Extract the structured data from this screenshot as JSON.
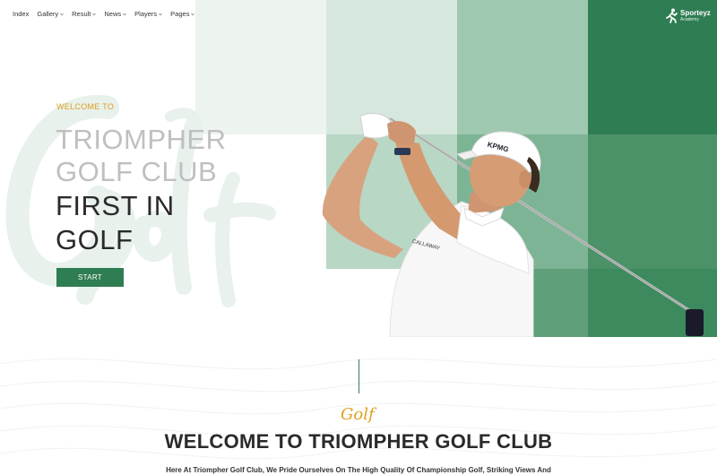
{
  "nav": {
    "items": [
      {
        "label": "Index",
        "has_dropdown": false
      },
      {
        "label": "Gallery",
        "has_dropdown": true
      },
      {
        "label": "Result",
        "has_dropdown": true
      },
      {
        "label": "News",
        "has_dropdown": true
      },
      {
        "label": "Players",
        "has_dropdown": true
      },
      {
        "label": "Pages",
        "has_dropdown": true
      }
    ]
  },
  "brand": {
    "name": "Sporteyz",
    "subtitle": "Academy",
    "icon": "runner-logo-icon"
  },
  "hero": {
    "kicker": "WELCOME TO",
    "title_line1": "TRIOMPHER",
    "title_line2": "GOLF CLUB",
    "title_line3": "FIRST IN",
    "title_line4": "GOLF",
    "decorative_script": "Golf",
    "cta_label": "START"
  },
  "intro": {
    "script_word": "Golf",
    "title": "WELCOME TO TRIOMPHER GOLF CLUB",
    "description": "Here At Triompher Golf Club, We Pride Ourselves On The High Quality Of Championship Golf, Striking Views And"
  },
  "colors": {
    "accent_green": "#2f7d52",
    "accent_gold": "#e0a020",
    "text_dark": "#2a2a2a",
    "text_light": "#bfbfbf"
  }
}
